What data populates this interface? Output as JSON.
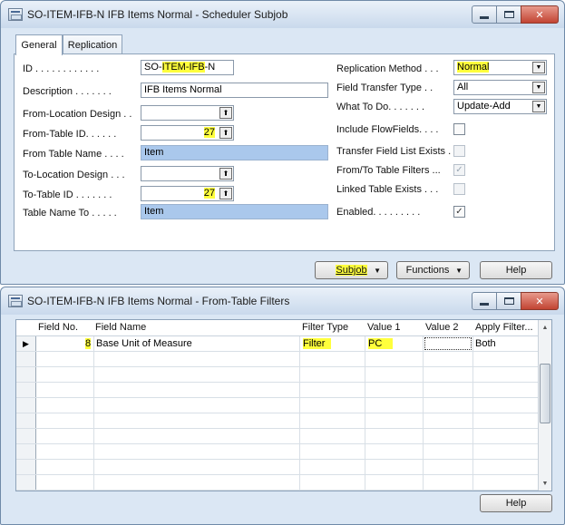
{
  "window1": {
    "title": "SO-ITEM-IFB-N IFB Items Normal - Scheduler Subjob",
    "tabs": [
      {
        "label": "General",
        "active": true
      },
      {
        "label": "Replication",
        "active": false
      }
    ],
    "left_fields": {
      "id": {
        "label": "ID . . . . . . . . . . . .",
        "value_pre": "SO-",
        "value_hl": "ITEM-IFB",
        "value_post": "-N"
      },
      "description": {
        "label": "Description . . . . . . .",
        "value": "IFB Items Normal"
      },
      "from_location": {
        "label": "From-Location Design . .",
        "value": ""
      },
      "from_table_id": {
        "label": "From-Table ID. . . . . .",
        "value": "27"
      },
      "from_table_name": {
        "label": "From Table Name . . . .",
        "value": "Item"
      },
      "to_location": {
        "label": "To-Location Design . . .",
        "value": ""
      },
      "to_table_id": {
        "label": "To-Table ID . . . . . . .",
        "value": "27"
      },
      "table_name_to": {
        "label": "Table Name To . . . . .",
        "value": "Item"
      }
    },
    "right_fields": {
      "replication_method": {
        "label": "Replication Method . . .",
        "value": "Normal"
      },
      "field_transfer_type": {
        "label": "Field Transfer Type . .",
        "value": "All"
      },
      "what_to_do": {
        "label": "What To Do. . . . . . .",
        "value": "Update-Add"
      },
      "include_flowfields": {
        "label": "Include FlowFields. . . .",
        "checked": false
      },
      "transfer_field_list_exists": {
        "label": "Transfer Field List Exists .",
        "checked": false
      },
      "from_to_table_filters": {
        "label": "From/To Table Filters ...",
        "checked": true
      },
      "linked_table_exists": {
        "label": "Linked Table Exists . . .",
        "checked": false
      },
      "enabled": {
        "label": "Enabled. . . . . . . . .",
        "checked": true
      }
    },
    "buttons": {
      "subjob": "Subjob",
      "functions": "Functions",
      "help": "Help"
    },
    "glyphs": {
      "check": "✓",
      "lookup": "⬆",
      "dropdown": "▼"
    }
  },
  "window2": {
    "title": "SO-ITEM-IFB-N IFB Items Normal - From-Table Filters",
    "columns": [
      "Field No.",
      "Field Name",
      "Filter Type",
      "Value 1",
      "Value 2",
      "Apply Filter..."
    ],
    "rows": [
      {
        "field_no": "8",
        "field_name": "Base Unit of Measure",
        "filter_type": "Filter",
        "value1": "PC",
        "value2": "",
        "apply_filter": "Both"
      }
    ],
    "row_selector_glyph": "▶",
    "help_label": "Help"
  },
  "colors": {
    "highlight": "#ffff3c",
    "field_blue": "#aac8ec",
    "window_bg": "#dbe7f4",
    "close_red": "#c24433"
  }
}
